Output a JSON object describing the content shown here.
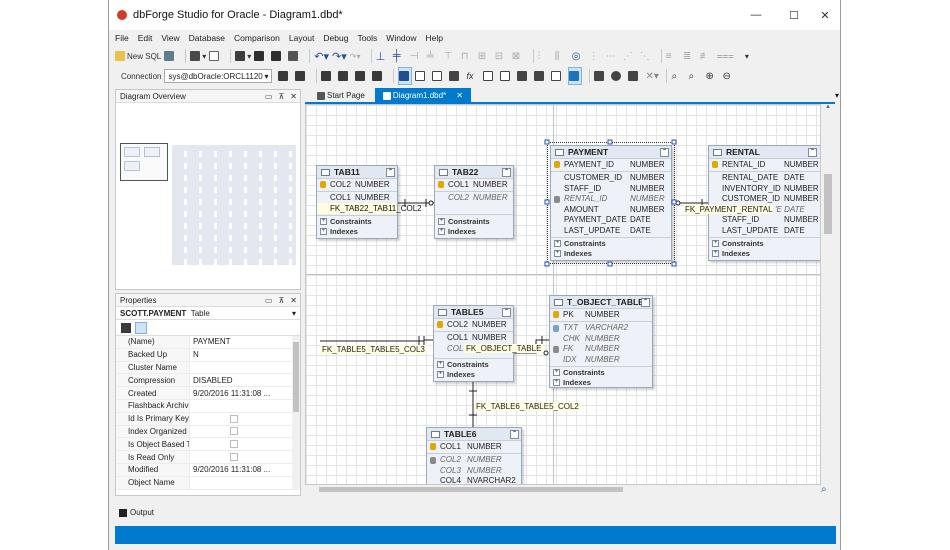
{
  "window": {
    "title": "dbForge Studio for Oracle - Diagram1.dbd*",
    "minimize": "—",
    "maximize": "☐",
    "close": "✕"
  },
  "menu": [
    "File",
    "Edit",
    "View",
    "Database",
    "Comparison",
    "Layout",
    "Debug",
    "Tools",
    "Window",
    "Help"
  ],
  "toolbar1": {
    "new_sql": "New SQL"
  },
  "toolbar2": {
    "connection_label": "Connection",
    "connection_value": "sys@dbOracle:ORCL1120"
  },
  "overview_panel": {
    "title": "Diagram Overview"
  },
  "properties_panel": {
    "title": "Properties",
    "object_name": "SCOTT.PAYMENT",
    "object_type": "Table",
    "rows": [
      {
        "name": "(Name)",
        "value": "PAYMENT",
        "kind": "text"
      },
      {
        "name": "Backed Up",
        "value": "N",
        "kind": "text"
      },
      {
        "name": "Cluster Name",
        "value": "",
        "kind": "text"
      },
      {
        "name": "Compression",
        "value": "DISABLED",
        "kind": "text"
      },
      {
        "name": "Created",
        "value": "9/20/2016 11:31:08 ...",
        "kind": "text"
      },
      {
        "name": "Flashback Archive Na",
        "value": "",
        "kind": "text"
      },
      {
        "name": "Id Is Primary Key",
        "value": "",
        "kind": "check"
      },
      {
        "name": "Index Organized",
        "value": "",
        "kind": "check"
      },
      {
        "name": "Is Object Based Table",
        "value": "",
        "kind": "check"
      },
      {
        "name": "Is Read Only",
        "value": "",
        "kind": "check"
      },
      {
        "name": "Modified",
        "value": "9/20/2016 11:31:08 ...",
        "kind": "text"
      },
      {
        "name": "Object Name",
        "value": "",
        "kind": "text"
      }
    ]
  },
  "doc_tabs": [
    {
      "label": "Start Page",
      "active": false
    },
    {
      "label": "Diagram1.dbd*",
      "active": true
    }
  ],
  "sections": {
    "constraints": "Constraints",
    "indexes": "Indexes"
  },
  "tables": [
    {
      "id": "tab11",
      "name": "TAB11",
      "columns": [
        {
          "name": "COL2",
          "type": "NUMBER",
          "key": "pk"
        },
        {
          "name": "COL1",
          "type": "NUMBER",
          "key": ""
        },
        {
          "name": "FK_TAB22_TAB11_COL2",
          "type": "",
          "key": "",
          "style": "fk"
        }
      ]
    },
    {
      "id": "tab22",
      "name": "TAB22",
      "columns": [
        {
          "name": "COL1",
          "type": "NUMBER",
          "key": "pk"
        },
        {
          "name": "COL2",
          "type": "NUMBER",
          "key": "",
          "style": "it"
        }
      ]
    },
    {
      "id": "payment",
      "name": "PAYMENT",
      "columns": [
        {
          "name": "PAYMENT_ID",
          "type": "NUMBER",
          "key": "pk"
        },
        {
          "name": "CUSTOMER_ID",
          "type": "NUMBER",
          "key": ""
        },
        {
          "name": "STAFF_ID",
          "type": "NUMBER",
          "key": ""
        },
        {
          "name": "RENTAL_ID",
          "type": "NUMBER",
          "key": "fk",
          "style": "it"
        },
        {
          "name": "AMOUNT",
          "type": "NUMBER",
          "key": ""
        },
        {
          "name": "PAYMENT_DATE",
          "type": "DATE",
          "key": ""
        },
        {
          "name": "LAST_UPDATE",
          "type": "DATE",
          "key": ""
        }
      ]
    },
    {
      "id": "rental",
      "name": "RENTAL",
      "columns": [
        {
          "name": "RENTAL_ID",
          "type": "NUMBER",
          "key": "pk"
        },
        {
          "name": "RENTAL_DATE",
          "type": "DATE",
          "key": ""
        },
        {
          "name": "INVENTORY_ID",
          "type": "NUMBER",
          "key": ""
        },
        {
          "name": "CUSTOMER_ID",
          "type": "NUMBER",
          "key": ""
        },
        {
          "name": "FK_PAYMENT_RENTAL",
          "type": "'E  DATE",
          "key": "",
          "style": "fk"
        },
        {
          "name": "STAFF_ID",
          "type": "NUMBER",
          "key": ""
        },
        {
          "name": "LAST_UPDATE",
          "type": "DATE",
          "key": ""
        }
      ]
    },
    {
      "id": "table5",
      "name": "TABLE5",
      "columns": [
        {
          "name": "COL2",
          "type": "NUMBER",
          "key": "pk"
        },
        {
          "name": "COL1",
          "type": "NUMBER",
          "key": ""
        },
        {
          "name": "COL",
          "type": "",
          "key": "",
          "style": "it"
        }
      ]
    },
    {
      "id": "tobject",
      "name": "T_OBJECT_TABLE",
      "columns": [
        {
          "name": "PK",
          "type": "NUMBER",
          "key": "pk"
        },
        {
          "name": "TXT",
          "type": "VARCHAR2",
          "key": "pk2",
          "style": "it"
        },
        {
          "name": "CHK",
          "type": "NUMBER",
          "key": "",
          "style": "it"
        },
        {
          "name": "FK",
          "type": "NUMBER",
          "key": "fk",
          "style": "it"
        },
        {
          "name": "IDX",
          "type": "NUMBER",
          "key": "",
          "style": "it"
        }
      ]
    },
    {
      "id": "table6",
      "name": "TABLE6",
      "columns": [
        {
          "name": "COL1",
          "type": "NUMBER",
          "key": "pk"
        },
        {
          "name": "COL2",
          "type": "NUMBER",
          "key": "fk",
          "style": "it"
        },
        {
          "name": "COL3",
          "type": "NUMBER",
          "key": "",
          "style": "it"
        },
        {
          "name": "COL4",
          "type": "NVARCHAR2",
          "key": ""
        }
      ]
    }
  ],
  "relations": {
    "fk_table5_table5_col3": "FK_TABLE5_TABLE5_COL3",
    "fk_object_table": "FK_OBJECT_TABLE",
    "fk_table6_table5_col2": "FK_TABLE6_TABLE5_COL2"
  },
  "output": {
    "label": "Output"
  },
  "colors": {
    "accent": "#007acc",
    "active_tab": "#007acc",
    "pk_key": "#e0a800",
    "fk_key": "#8a8a8a"
  }
}
